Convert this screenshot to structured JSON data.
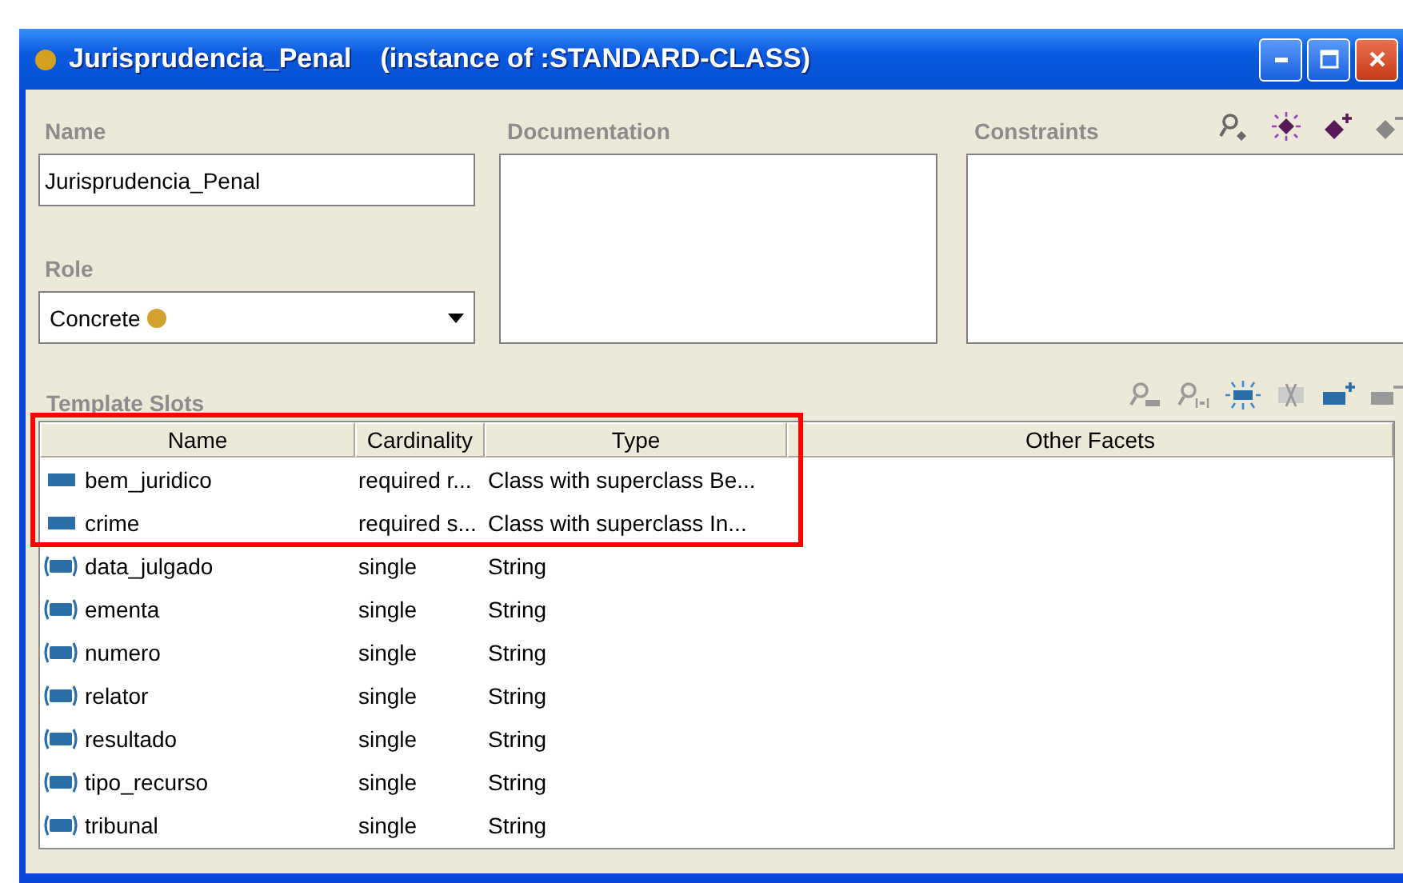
{
  "window": {
    "title": "Jurisprudencia_Penal",
    "subtitle": "(instance of :STANDARD-CLASS)"
  },
  "name": {
    "label": "Name",
    "value": "Jurisprudencia_Penal"
  },
  "role": {
    "label": "Role",
    "value": "Concrete"
  },
  "documentation": {
    "label": "Documentation"
  },
  "constraints": {
    "label": "Constraints"
  },
  "template_slots": {
    "label": "Template Slots",
    "columns": [
      "Name",
      "Cardinality",
      "Type",
      "Other Facets"
    ],
    "rows": [
      {
        "kind": "own",
        "highlighted": true,
        "name": "bem_juridico",
        "cardinality": "required r...",
        "type": "Class with superclass Be..."
      },
      {
        "kind": "own",
        "highlighted": true,
        "name": "crime",
        "cardinality": "required s...",
        "type": "Class with superclass In..."
      },
      {
        "kind": "inherited",
        "highlighted": false,
        "name": "data_julgado",
        "cardinality": "single",
        "type": "String"
      },
      {
        "kind": "inherited",
        "highlighted": false,
        "name": "ementa",
        "cardinality": "single",
        "type": "String"
      },
      {
        "kind": "inherited",
        "highlighted": false,
        "name": "numero",
        "cardinality": "single",
        "type": "String"
      },
      {
        "kind": "inherited",
        "highlighted": false,
        "name": "relator",
        "cardinality": "single",
        "type": "String"
      },
      {
        "kind": "inherited",
        "highlighted": false,
        "name": "resultado",
        "cardinality": "single",
        "type": "String"
      },
      {
        "kind": "inherited",
        "highlighted": false,
        "name": "tipo_recurso",
        "cardinality": "single",
        "type": "String"
      },
      {
        "kind": "inherited",
        "highlighted": false,
        "name": "tribunal",
        "cardinality": "single",
        "type": "String"
      }
    ]
  }
}
